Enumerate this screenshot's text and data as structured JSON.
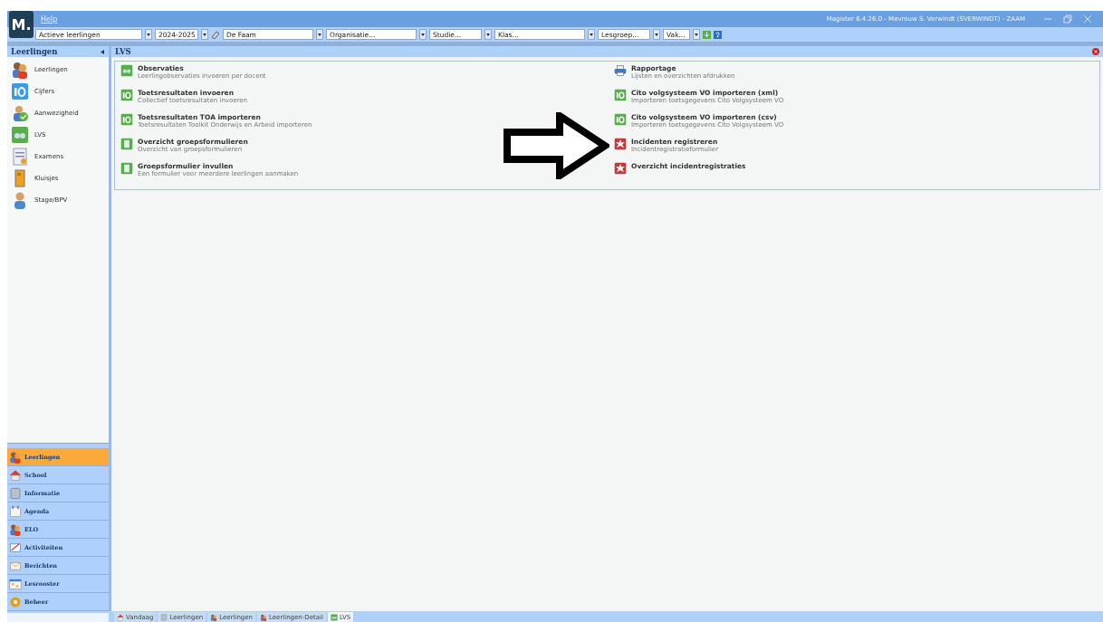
{
  "logo": "M.",
  "menu": [
    "Help"
  ],
  "window": {
    "title": "Magister 6.4.26.0 - Mevrouw S. Verwindt (SVERWINDT) - ZAAM"
  },
  "toolbar": [
    {
      "value": "Actieve leerlingen",
      "kind": "wide"
    },
    {
      "value": "2024-2025",
      "kind": "narrow"
    },
    {
      "value": "De Faam",
      "kind": "school"
    },
    {
      "value": "Organisatie...",
      "kind": "medium"
    },
    {
      "value": "Studie...",
      "kind": "small"
    },
    {
      "value": "Klas...",
      "kind": "medium"
    },
    {
      "value": "Lesgroep...",
      "kind": "small"
    },
    {
      "value": "Vak...",
      "kind": "tiny"
    }
  ],
  "sidebar": {
    "title": "Leerlingen",
    "items": [
      {
        "label": "Leerlingen",
        "kind": "people"
      },
      {
        "label": "Cijfers",
        "kind": "grade"
      },
      {
        "label": "Aanwezigheid",
        "kind": "check"
      },
      {
        "label": "LVS",
        "kind": "lvs"
      },
      {
        "label": "Examens",
        "kind": "exam"
      },
      {
        "label": "Kluisjes",
        "kind": "locker"
      },
      {
        "label": "Stage/BPV",
        "kind": "person"
      }
    ],
    "nav": [
      {
        "label": "Leerlingen",
        "kind": "people",
        "selected": true
      },
      {
        "label": "School",
        "kind": "school",
        "selected": false
      },
      {
        "label": "Informatie",
        "kind": "info",
        "selected": false
      },
      {
        "label": "Agenda",
        "kind": "calendar",
        "selected": false
      },
      {
        "label": "ELO",
        "kind": "people",
        "selected": false
      },
      {
        "label": "Activiteiten",
        "kind": "pen",
        "selected": false
      },
      {
        "label": "Berichten",
        "kind": "mail",
        "selected": false
      },
      {
        "label": "Lesrooster",
        "kind": "schedule",
        "selected": false
      },
      {
        "label": "Beheer",
        "kind": "gear",
        "selected": false
      }
    ]
  },
  "main": {
    "title": "LVS",
    "columns": [
      [
        {
          "title": "Observaties",
          "subtitle": "Leerlingobservaties invoeren per docent",
          "kind": "lvs"
        },
        {
          "title": "Toetsresultaten invoeren",
          "subtitle": "Collectief toetsresultaten invoeren",
          "kind": "grade"
        },
        {
          "title": "Toetsresultaten TOA importeren",
          "subtitle": "Toetsresultaten Toolkit Onderwijs en Arbeid importeren",
          "kind": "grade"
        },
        {
          "title": "Overzicht groepsformulieren",
          "subtitle": "Overzicht van groepsformulieren",
          "kind": "form"
        },
        {
          "title": "Groepsformulier invullen",
          "subtitle": "Een formulier voor meerdere leerlingen aanmaken",
          "kind": "form"
        }
      ],
      [
        {
          "title": "Rapportage",
          "subtitle": "Lijsten en overzichten afdrukken",
          "kind": "print"
        },
        {
          "title": "Cito volgsysteem VO importeren (xml)",
          "subtitle": "Importeren toetsgegevens Cito Volgsysteem VO",
          "kind": "grade"
        },
        {
          "title": "Cito volgsysteem VO importeren (csv)",
          "subtitle": "Importeren toetsgegevens Cito Volgsysteem VO",
          "kind": "grade"
        },
        {
          "title": "Incidenten registreren",
          "subtitle": "Incidentregistratieformulier",
          "kind": "incident"
        },
        {
          "title": "Overzicht incidentregistraties",
          "kind": "incident"
        }
      ]
    ]
  },
  "tabs": [
    {
      "label": "Vandaag",
      "kind": "school",
      "selected": false
    },
    {
      "label": "Leerlingen",
      "kind": "info",
      "selected": false
    },
    {
      "label": "Leerlingen",
      "kind": "people",
      "selected": false
    },
    {
      "label": "Leerlingen-Detail",
      "kind": "people",
      "selected": false
    },
    {
      "label": "LVS",
      "kind": "lvs",
      "selected": true
    }
  ]
}
